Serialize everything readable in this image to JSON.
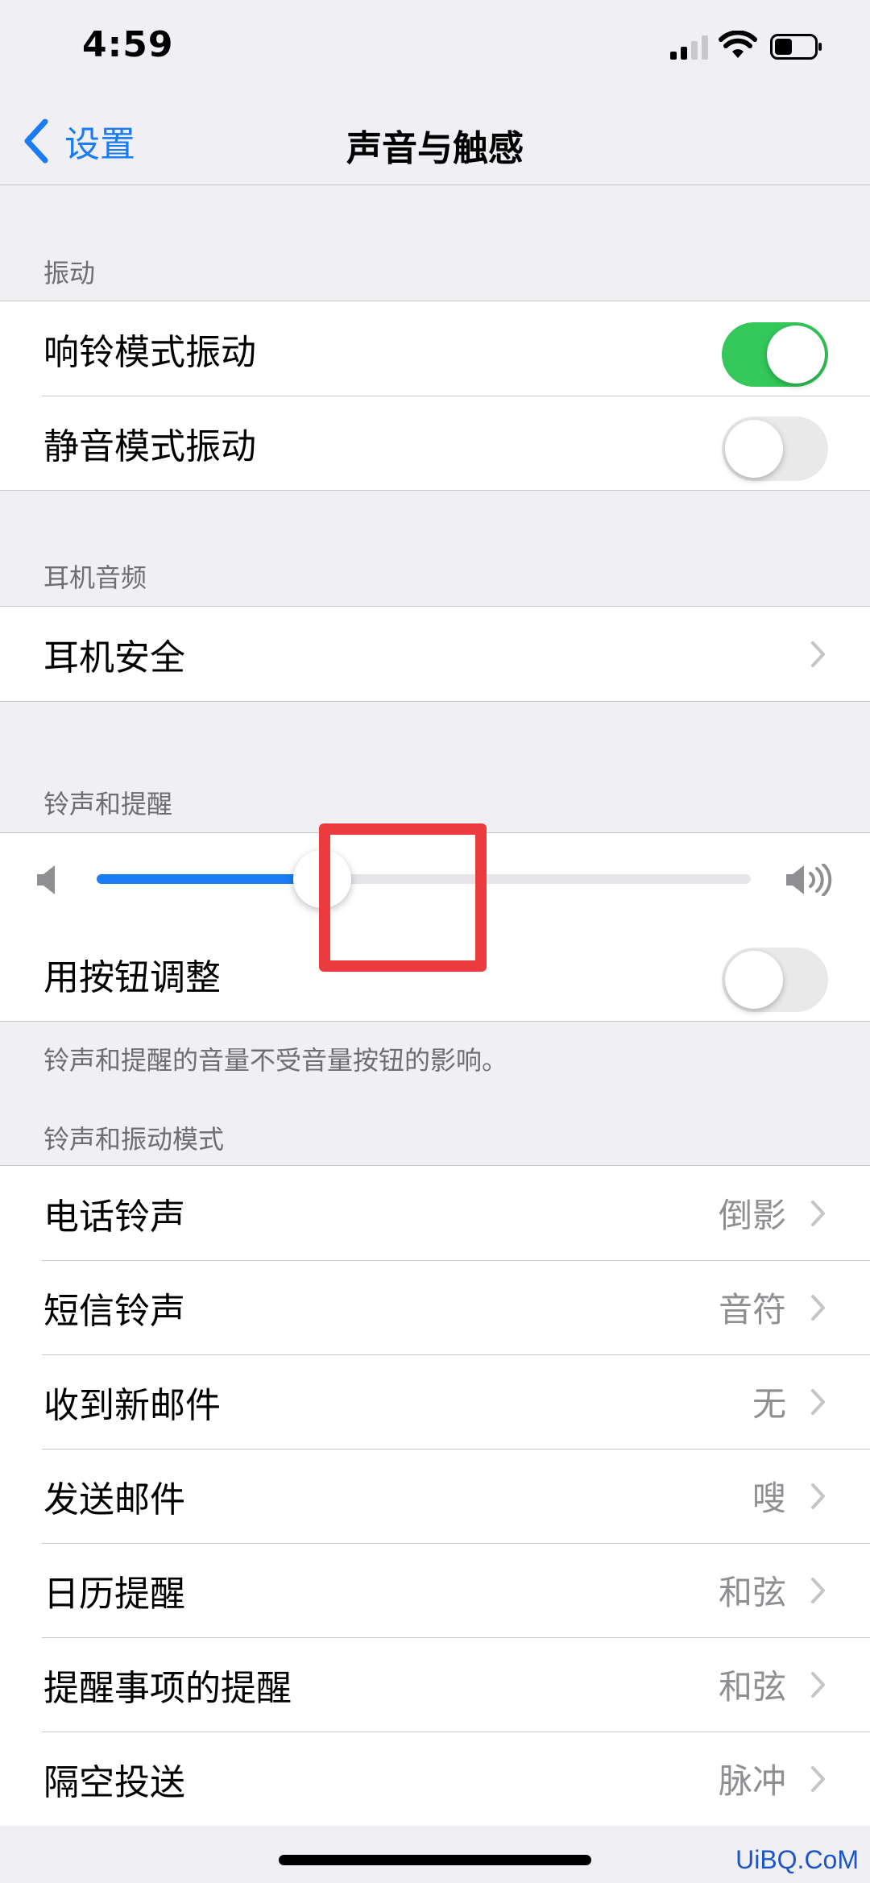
{
  "status_bar": {
    "time": "4:59"
  },
  "nav": {
    "back_label": "设置",
    "title": "声音与触感"
  },
  "vibration": {
    "header": "振动",
    "rows": [
      {
        "label": "响铃模式振动",
        "on": true
      },
      {
        "label": "静音模式振动",
        "on": false
      }
    ]
  },
  "headphone_audio": {
    "header": "耳机音频",
    "rows": [
      {
        "label": "耳机安全"
      }
    ]
  },
  "ringer": {
    "header": "铃声和提醒",
    "volume_fraction": 0.32,
    "change_with_buttons": {
      "label": "用按钮调整",
      "on": false
    },
    "footer": "铃声和提醒的音量不受音量按钮的影响。"
  },
  "patterns": {
    "header": "铃声和振动模式",
    "rows": [
      {
        "label": "电话铃声",
        "value": "倒影"
      },
      {
        "label": "短信铃声",
        "value": "音符"
      },
      {
        "label": "收到新邮件",
        "value": "无"
      },
      {
        "label": "发送邮件",
        "value": "嗖"
      },
      {
        "label": "日历提醒",
        "value": "和弦"
      },
      {
        "label": "提醒事项的提醒",
        "value": "和弦"
      },
      {
        "label": "隔空投送",
        "value": "脉冲"
      }
    ]
  },
  "colors": {
    "accent": "#1a7cf5",
    "toggle_on": "#34c759",
    "highlight": "#ec3b3e"
  },
  "watermark": "UiBQ.CoM"
}
